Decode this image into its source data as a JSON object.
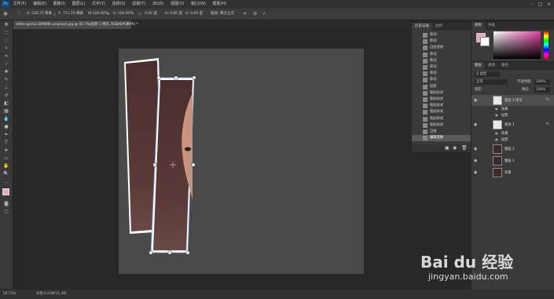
{
  "menu": {
    "app_badge": "Ps",
    "items": [
      "文件(F)",
      "编辑(E)",
      "图像(I)",
      "图层(L)",
      "文字(Y)",
      "选择(S)",
      "滤镜(T)",
      "3D(D)",
      "视图(V)",
      "窗口(W)",
      "帮助(H)"
    ],
    "window_controls": [
      "–",
      "□",
      "×"
    ]
  },
  "options": {
    "x_label": "X:",
    "x_value": "226.75 像素",
    "y_label": "Y:",
    "y_value": "711.19 像素",
    "w_label": "W:",
    "w_value": "100.00%",
    "h_label": "H:",
    "h_value": "100.00%",
    "angle_label": "△",
    "angle_value": "0.00 度",
    "hskew_label": "H:",
    "hskew_value": "0.00 度",
    "vskew_label": "V:",
    "vskew_value": "0.00 度",
    "interp_label": "插值:",
    "interp_value": "两次立方"
  },
  "document": {
    "tab_title": "eddie-garcia-309896-unsplash.jpg @ 56.7%(投影 1 拷贝, RGB/8#CMYK) *",
    "tab_close": "×"
  },
  "status": {
    "zoom": "56.71%",
    "doc_info": "文档:2.63M/11.4M"
  },
  "history_panel": {
    "tabs": [
      "历史记录",
      "动作"
    ],
    "items": [
      "移动",
      "移动",
      "自由变换",
      "移动",
      "移动",
      "移动",
      "移动",
      "移动",
      "投影",
      "粘贴样式",
      "粘贴样式",
      "粘贴样式",
      "粘贴样式",
      "粘贴样式",
      "粘贴样式",
      "自由",
      "编辑变换"
    ],
    "selected_index": 16
  },
  "color_panel": {
    "tabs": [
      "颜色",
      "色板"
    ],
    "foreground": "#e8a8c8",
    "background": "#ffffff"
  },
  "layers_panel": {
    "tabs": [
      "图层",
      "通道",
      "路径"
    ],
    "filter_label": "Q 类型",
    "blend_mode": "正常",
    "opacity_label": "不透明度:",
    "opacity_value": "100%",
    "lock_label": "锁定:",
    "fill_label": "填充:",
    "fill_value": "100%",
    "layers": [
      {
        "name": "矩形 1 拷贝",
        "fx": "fx",
        "sub": [
          "效果",
          "投影"
        ],
        "selected": true
      },
      {
        "name": "矩形 1",
        "fx": "fx",
        "sub": [
          "效果",
          "投影"
        ],
        "selected": false
      },
      {
        "name": "图层 2",
        "fx": "",
        "sub": [],
        "selected": false
      },
      {
        "name": "图层 1",
        "fx": "",
        "sub": [],
        "selected": false
      },
      {
        "name": "背景",
        "fx": "",
        "sub": [],
        "selected": false
      }
    ]
  },
  "watermark": {
    "brand": "Bai du 经验",
    "url": "jingyan.baidu.com"
  }
}
